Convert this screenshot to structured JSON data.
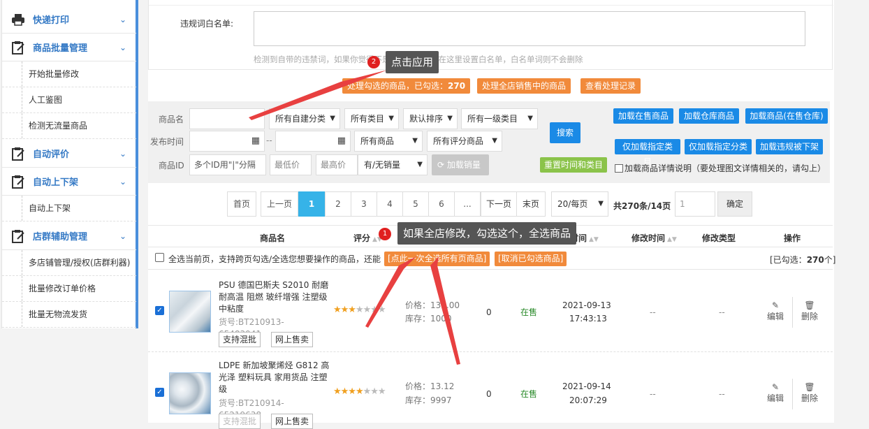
{
  "sidebar": {
    "sections": [
      {
        "label": "快递打印",
        "icon": "printer-icon"
      },
      {
        "label": "商品批量管理",
        "icon": "clipboard-icon"
      },
      {
        "label": "自动评价",
        "icon": "clipboard-icon"
      },
      {
        "label": "自动上下架",
        "icon": "clipboard-icon"
      },
      {
        "label": "店群辅助管理",
        "icon": "clipboard-icon"
      }
    ],
    "items": [
      "开始批量修改",
      "人工鉴图",
      "检测无流量商品",
      "自动上下架",
      "多店铺管理/授权(店群利器)",
      "批量修改订单价格",
      "批量无物流发货"
    ]
  },
  "whitelist": {
    "label": "违规词白名单:",
    "hint": "检测到自带的违禁词，如果你觉得不是违禁词，可以在这里设置白名单，白名单词则不会删除"
  },
  "actions": {
    "process_selected": "处理勾选的商品，已勾选：",
    "selected_count": "270",
    "process_all": "处理全店销售中的商品",
    "view_records": "查看处理记录"
  },
  "filters": {
    "name_label": "商品名",
    "time_label": "发布时间",
    "id_label": "商品ID",
    "id_placeholder": "多个ID用\"|\"分隔",
    "min_price": "最低价",
    "max_price": "最高价",
    "category_self": "所有自建分类",
    "category_all": "所有类目",
    "sort_default": "默认排序",
    "category_top": "所有一级类目",
    "goods_all": "所有商品",
    "rating_all": "所有评分商品",
    "sales_option": "有/无销量",
    "date_sep": "--",
    "load_sales": "加载销量",
    "search": "搜索",
    "reset": "重置时间和类目",
    "load_buttons": [
      "加载在售商品",
      "加载仓库商品",
      "加载商品(在售仓库)",
      "仅加载指定类目",
      "仅加载指定分类",
      "加载违规被下架"
    ],
    "detail_check": "加载商品详情说明（要处理图文详情相关的，请勾上）"
  },
  "pagination": {
    "first": "首页",
    "prev": "上一页",
    "pages": [
      "1",
      "2",
      "3",
      "4",
      "5",
      "6",
      "..."
    ],
    "next": "下一页",
    "last": "末页",
    "per_page": "20/每页",
    "total_prefix": "共",
    "total": "270条/14页",
    "jump_value": "1",
    "confirm": "确定"
  },
  "table": {
    "headers": {
      "name": "商品名",
      "rating": "评分",
      "time": "时间",
      "modify_time": "修改时间",
      "modify_type": "修改类型",
      "ops": "操作"
    },
    "select_all_text": "全选当前页，支持跨页勾选/全选您想要操作的商品，还能",
    "select_all_pages": "[点此一次全选所有页商品]",
    "cancel_selected": "[取消已勾选商品]",
    "selected_label": "[已勾选：",
    "selected_count": "270",
    "selected_suffix": "个]",
    "rows": [
      {
        "title": "PSU 德国巴斯夫 S2010 耐磨耐高温 阻燃 玻纤增强 注塑级 中粘度",
        "sku": "货号:BT210913-",
        "sku2": "654839411302",
        "tag1": "支持混批",
        "tag2": "网上售卖",
        "stars": 3,
        "price": "价格：135.00",
        "stock": "库存：1000",
        "sales": "0",
        "status": "在售",
        "date": "2021-09-13",
        "time": "17:43:13",
        "m1": "--",
        "m2": "--",
        "edit": "编辑",
        "del": "删除"
      },
      {
        "title": "LDPE 新加坡聚烯烃 G812 高光泽 塑料玩具 家用货品 注塑级",
        "sku": "货号:BT210914-",
        "sku2": "652196386...",
        "tag1": "支持混批",
        "tag2": "网上售卖",
        "stars": 4,
        "price": "价格：13.12",
        "stock": "库存：9997",
        "sales": "0",
        "status": "在售",
        "date": "2021-09-14",
        "time": "20:07:29",
        "m1": "--",
        "m2": "--",
        "edit": "编辑",
        "del": "删除"
      }
    ]
  },
  "annotations": {
    "badge1": "1",
    "tip1": "如果全店修改，勾选这个，全选商品",
    "badge2": "2",
    "tip2": "点击应用"
  },
  "colors": {
    "accent": "#3479c5",
    "orange": "#f18a3b",
    "blue": "#1a8ae6",
    "green": "#8bc34a",
    "active_page": "#36b3e8",
    "arrow": "#e84040"
  }
}
